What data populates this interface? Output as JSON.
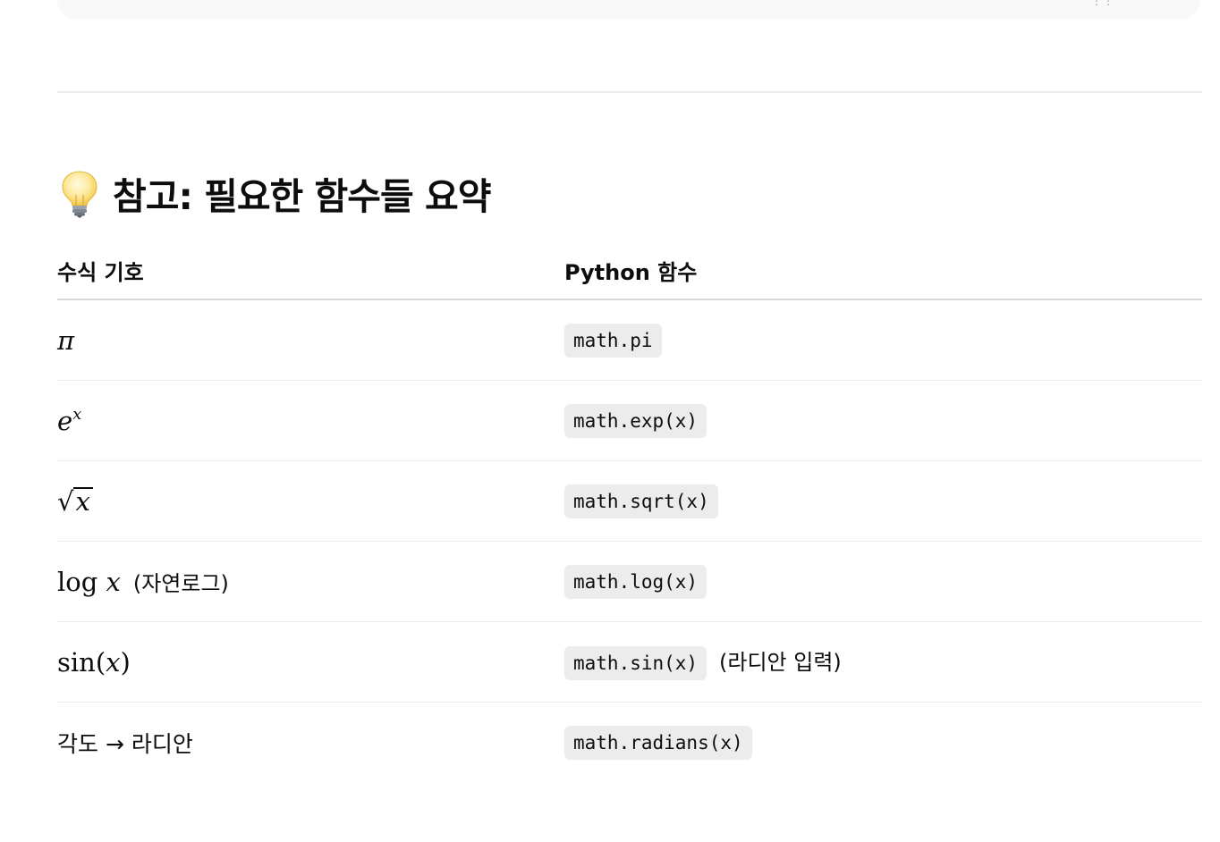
{
  "code_block": {
    "corner_glyph": "⋮⋮"
  },
  "section": {
    "icon": "lightbulb-icon",
    "title": "참고: 필요한 함수들 요약"
  },
  "table": {
    "headers": [
      "수식 기호",
      "Python 함수"
    ],
    "rows": [
      {
        "symbol": "π",
        "function": "math.pi"
      },
      {
        "symbol": "e^x",
        "base": "e",
        "exponent": "x",
        "function": "math.exp(x)"
      },
      {
        "symbol": "√x",
        "radicand": "x",
        "function": "math.sqrt(x)"
      },
      {
        "symbol": "log x",
        "op": "log",
        "arg": "x",
        "note": "(자연로그)",
        "function": "math.log(x)"
      },
      {
        "symbol": "sin(x)",
        "op": "sin",
        "arg": "x",
        "function": "math.sin(x)",
        "function_note": "(라디안 입력)"
      },
      {
        "symbol": "각도 → 라디안",
        "function": "math.radians(x)"
      }
    ]
  }
}
